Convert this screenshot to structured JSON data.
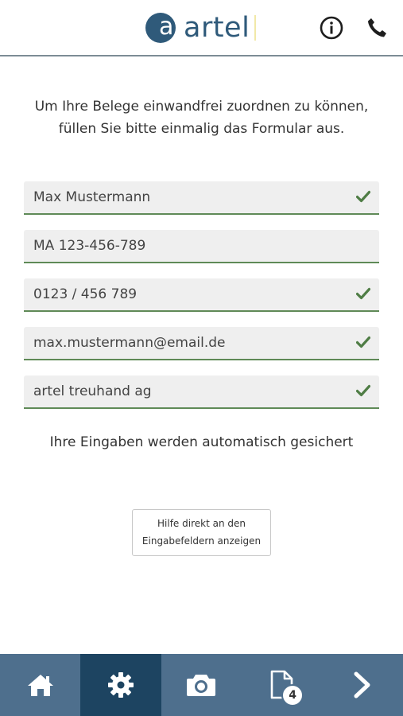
{
  "header": {
    "logo_mark": "a",
    "logo_text": "artel",
    "info_icon": "info-icon",
    "phone_icon": "phone-icon"
  },
  "intro": {
    "line1": "Um Ihre Belege einwandfrei zuordnen zu können,",
    "line2": "füllen Sie bitte einmalig das Formular aus."
  },
  "form": {
    "fields": [
      {
        "value": "Max Mustermann",
        "valid": true
      },
      {
        "value": "MA 123-456-789",
        "valid": false
      },
      {
        "value": "0123 / 456 789",
        "valid": true
      },
      {
        "value": "max.mustermann@email.de",
        "valid": true
      },
      {
        "value": "artel treuhand ag",
        "valid": true
      }
    ],
    "autosave_note": "Ihre Eingaben werden automatisch gesichert"
  },
  "help_button": {
    "line1": "Hilfe direkt an den",
    "line2": "Eingabefeldern anzeigen"
  },
  "tabbar": {
    "active_tab": "settings",
    "documents_badge": "4",
    "icons": [
      "home-icon",
      "gear-icon",
      "camera-icon",
      "document-icon",
      "chevron-right-icon"
    ]
  },
  "colors": {
    "brand": "#2f5a7a",
    "valid_green": "#5f8a57",
    "tabbar": "#4e6f8d",
    "tabbar_active": "#1d4461"
  }
}
